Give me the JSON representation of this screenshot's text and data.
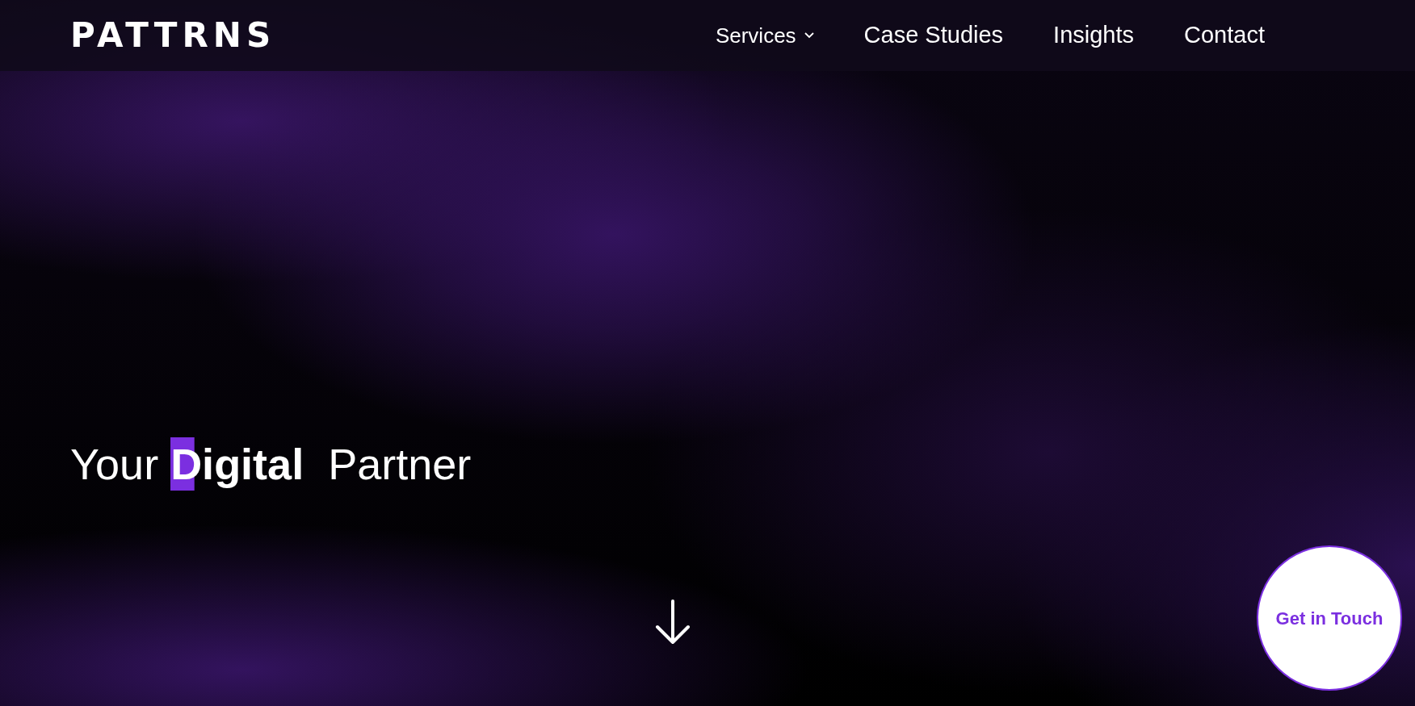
{
  "logo": "PATTRNS",
  "nav": [
    {
      "label": "Services",
      "dropdown": true
    },
    {
      "label": "Case Studies",
      "dropdown": false
    },
    {
      "label": "Insights",
      "dropdown": false
    },
    {
      "label": "Contact",
      "dropdown": false
    }
  ],
  "hero": {
    "headline": "Your **Digital**  Partner"
  },
  "cta": "Get in Touch"
}
